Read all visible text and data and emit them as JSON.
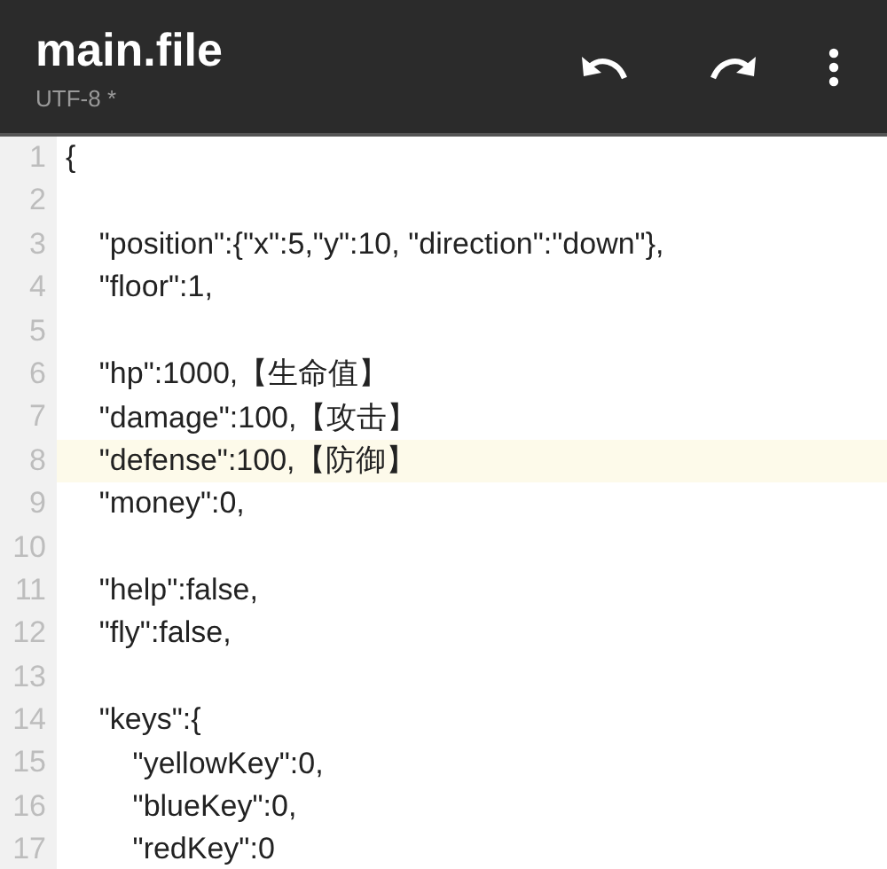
{
  "toolbar": {
    "title": "main.file",
    "subtitle": "UTF-8 *"
  },
  "lines": [
    {
      "number": "1",
      "text": "{",
      "selected": false
    },
    {
      "number": "2",
      "selected": false
    },
    {
      "number": "3",
      "text": "    \"position\":{\"x\":5,\"y\":10, \"direction\":\"down\"},",
      "selected": false
    },
    {
      "number": "4",
      "text": "    \"floor\":1,",
      "selected": false
    },
    {
      "number": "5",
      "selected": false
    },
    {
      "number": "6",
      "text": "    \"hp\":1000,【生命值】",
      "selected": false
    },
    {
      "number": "7",
      "text": "    \"damage\":100,【攻击】",
      "selected": false
    },
    {
      "number": "8",
      "text": "    \"defense\":100,【防御】",
      "selected": true
    },
    {
      "number": "9",
      "text": "    \"money\":0,",
      "selected": false
    },
    {
      "number": "10",
      "selected": false
    },
    {
      "number": "11",
      "text": "    \"help\":false,",
      "selected": false
    },
    {
      "number": "12",
      "text": "    \"fly\":false,",
      "selected": false
    },
    {
      "number": "13",
      "selected": false
    },
    {
      "number": "14",
      "text": "    \"keys\":{",
      "selected": false
    },
    {
      "number": "15",
      "text": "        \"yellowKey\":0,",
      "selected": false
    },
    {
      "number": "16",
      "text": "        \"blueKey\":0,",
      "selected": false
    },
    {
      "number": "17",
      "text": "        \"redKey\":0",
      "selected": false
    }
  ]
}
